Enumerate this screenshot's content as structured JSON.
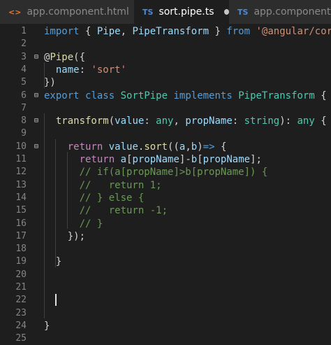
{
  "tabs": [
    {
      "icon": "<>",
      "label": "app.component.html"
    },
    {
      "icon": "TS",
      "label": "sort.pipe.ts"
    },
    {
      "icon": "TS",
      "label": "app.component.ts"
    }
  ],
  "lines": [
    {
      "n": "1",
      "fold": "",
      "tokens": [
        [
          "kw",
          "import"
        ],
        [
          "p",
          " { "
        ],
        [
          "var",
          "Pipe"
        ],
        [
          "p",
          ", "
        ],
        [
          "var",
          "PipeTransform"
        ],
        [
          "p",
          " } "
        ],
        [
          "kw",
          "from"
        ],
        [
          "p",
          " "
        ],
        [
          "str",
          "'@angular/core'"
        ],
        [
          "p",
          ";"
        ]
      ]
    },
    {
      "n": "2",
      "fold": "",
      "tokens": []
    },
    {
      "n": "3",
      "fold": "⊟",
      "tokens": [
        [
          "p",
          "@"
        ],
        [
          "fn",
          "Pipe"
        ],
        [
          "p",
          "({"
        ]
      ]
    },
    {
      "n": "4",
      "fold": "",
      "tokens": [
        [
          "p",
          "  "
        ],
        [
          "var",
          "name"
        ],
        [
          "p",
          ": "
        ],
        [
          "str",
          "'sort'"
        ]
      ]
    },
    {
      "n": "5",
      "fold": "",
      "tokens": [
        [
          "p",
          "})"
        ]
      ]
    },
    {
      "n": "6",
      "fold": "⊟",
      "tokens": [
        [
          "kw",
          "export"
        ],
        [
          "p",
          " "
        ],
        [
          "kw",
          "class"
        ],
        [
          "p",
          " "
        ],
        [
          "type",
          "SortPipe"
        ],
        [
          "p",
          " "
        ],
        [
          "kw",
          "implements"
        ],
        [
          "p",
          " "
        ],
        [
          "type",
          "PipeTransform"
        ],
        [
          "p",
          " {"
        ]
      ]
    },
    {
      "n": "7",
      "fold": "",
      "tokens": []
    },
    {
      "n": "8",
      "fold": "⊟",
      "tokens": [
        [
          "p",
          "  "
        ],
        [
          "fn",
          "transform"
        ],
        [
          "p",
          "("
        ],
        [
          "var",
          "value"
        ],
        [
          "p",
          ": "
        ],
        [
          "type",
          "any"
        ],
        [
          "p",
          ", "
        ],
        [
          "var",
          "propName"
        ],
        [
          "p",
          ": "
        ],
        [
          "type",
          "string"
        ],
        [
          "p",
          "): "
        ],
        [
          "type",
          "any"
        ],
        [
          "p",
          " {"
        ]
      ]
    },
    {
      "n": "9",
      "fold": "",
      "tokens": []
    },
    {
      "n": "10",
      "fold": "⊟",
      "tokens": [
        [
          "p",
          "    "
        ],
        [
          "ctl",
          "return"
        ],
        [
          "p",
          " "
        ],
        [
          "var",
          "value"
        ],
        [
          "p",
          "."
        ],
        [
          "fn",
          "sort"
        ],
        [
          "p",
          "(("
        ],
        [
          "var",
          "a"
        ],
        [
          "p",
          ","
        ],
        [
          "var",
          "b"
        ],
        [
          "p",
          ")"
        ],
        [
          "kw",
          "=>"
        ],
        [
          "p",
          " {"
        ]
      ]
    },
    {
      "n": "11",
      "fold": "",
      "tokens": [
        [
          "p",
          "      "
        ],
        [
          "ctl",
          "return"
        ],
        [
          "p",
          " "
        ],
        [
          "var",
          "a"
        ],
        [
          "p",
          "["
        ],
        [
          "var",
          "propName"
        ],
        [
          "p",
          "]-"
        ],
        [
          "var",
          "b"
        ],
        [
          "p",
          "["
        ],
        [
          "var",
          "propName"
        ],
        [
          "p",
          "];"
        ]
      ]
    },
    {
      "n": "12",
      "fold": "",
      "tokens": [
        [
          "p",
          "      "
        ],
        [
          "com",
          "// if(a[propName]>b[propName]) {"
        ]
      ]
    },
    {
      "n": "13",
      "fold": "",
      "tokens": [
        [
          "p",
          "      "
        ],
        [
          "com",
          "//   return 1;"
        ]
      ]
    },
    {
      "n": "14",
      "fold": "",
      "tokens": [
        [
          "p",
          "      "
        ],
        [
          "com",
          "// } else {"
        ]
      ]
    },
    {
      "n": "15",
      "fold": "",
      "tokens": [
        [
          "p",
          "      "
        ],
        [
          "com",
          "//   return -1;"
        ]
      ]
    },
    {
      "n": "16",
      "fold": "",
      "tokens": [
        [
          "p",
          "      "
        ],
        [
          "com",
          "// }"
        ]
      ]
    },
    {
      "n": "17",
      "fold": "",
      "tokens": [
        [
          "p",
          "    "
        ],
        [
          "p",
          "});"
        ]
      ]
    },
    {
      "n": "18",
      "fold": "",
      "tokens": []
    },
    {
      "n": "19",
      "fold": "",
      "tokens": [
        [
          "p",
          "  "
        ],
        [
          "p",
          "}"
        ]
      ]
    },
    {
      "n": "20",
      "fold": "",
      "tokens": []
    },
    {
      "n": "21",
      "fold": "",
      "tokens": []
    },
    {
      "n": "22",
      "fold": "",
      "tokens": []
    },
    {
      "n": "23",
      "fold": "",
      "tokens": []
    },
    {
      "n": "24",
      "fold": "",
      "tokens": [
        [
          "p",
          "}"
        ]
      ]
    },
    {
      "n": "25",
      "fold": "",
      "tokens": []
    }
  ],
  "colors": {
    "background": "#1e1e1e",
    "keyword": "#569cd6",
    "control": "#c586c0",
    "type": "#4ec9b0",
    "function": "#dcdcaa",
    "variable": "#9cdcfe",
    "string": "#ce9178",
    "comment": "#6a9955"
  }
}
